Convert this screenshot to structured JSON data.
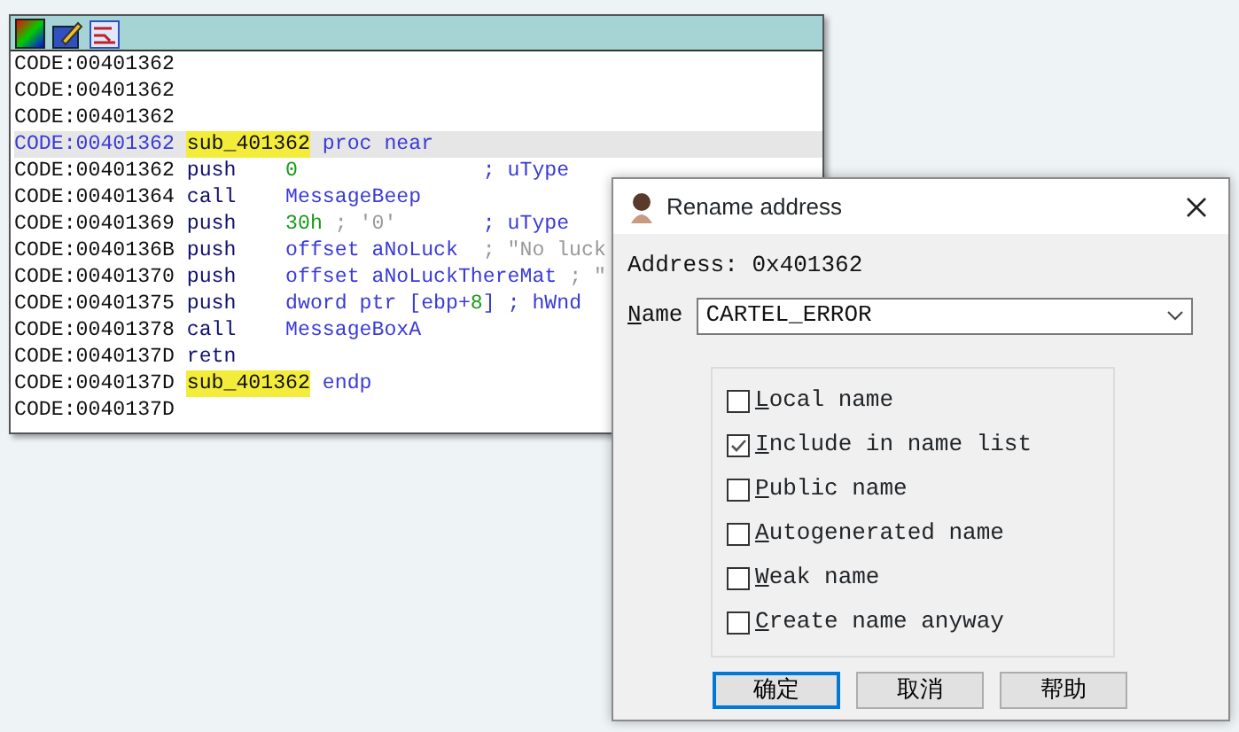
{
  "code_window": {
    "lines": [
      {
        "selected": false,
        "addr": "CODE:00401362"
      },
      {
        "selected": false,
        "addr": "CODE:00401362"
      },
      {
        "selected": false,
        "addr": "CODE:00401362"
      },
      {
        "selected": true,
        "addr": "CODE:00401362",
        "label": "sub_401362",
        "mnem": "proc near",
        "kind": "directive"
      },
      {
        "selected": false,
        "addr": "CODE:00401362",
        "mnem": "push",
        "ops": [
          {
            "kind": "num",
            "text": "0"
          }
        ],
        "cmt": [
          {
            "kind": "cmt",
            "text": "; uType"
          }
        ]
      },
      {
        "selected": false,
        "addr": "CODE:00401364",
        "mnem": "call",
        "ops": [
          {
            "kind": "name",
            "text": "MessageBeep"
          }
        ]
      },
      {
        "selected": false,
        "addr": "CODE:00401369",
        "mnem": "push",
        "ops": [
          {
            "kind": "num",
            "text": "30h"
          },
          {
            "kind": "str",
            "text": " ; '0'"
          }
        ],
        "cmt": [
          {
            "kind": "cmt",
            "text": "; uType"
          }
        ]
      },
      {
        "selected": false,
        "addr": "CODE:0040136B",
        "mnem": "push",
        "ops": [
          {
            "kind": "name",
            "text": "offset aNoLuck"
          }
        ],
        "cmt": [
          {
            "kind": "str",
            "text": "; \"No luck"
          }
        ]
      },
      {
        "selected": false,
        "addr": "CODE:00401370",
        "mnem": "push",
        "ops": [
          {
            "kind": "name",
            "text": "offset aNoLuckThereMat"
          }
        ],
        "cmt": [
          {
            "kind": "str",
            "text": "; \""
          }
        ]
      },
      {
        "selected": false,
        "addr": "CODE:00401375",
        "mnem": "push",
        "ops": [
          {
            "kind": "name",
            "text": "dword ptr [ebp+"
          },
          {
            "kind": "num",
            "text": "8"
          },
          {
            "kind": "name",
            "text": "]"
          }
        ],
        "cmt": [
          {
            "kind": "cmt",
            "text": "; hWnd"
          }
        ]
      },
      {
        "selected": false,
        "addr": "CODE:00401378",
        "mnem": "call",
        "ops": [
          {
            "kind": "name",
            "text": "MessageBoxA"
          }
        ]
      },
      {
        "selected": false,
        "addr": "CODE:0040137D",
        "mnem": "retn"
      },
      {
        "selected": false,
        "addr": "CODE:0040137D",
        "label": "sub_401362",
        "mnem": "endp",
        "kind": "directive"
      },
      {
        "selected": false,
        "addr": "CODE:0040137D"
      }
    ]
  },
  "dialog": {
    "title": "Rename address",
    "address": "Address: 0x401362",
    "name_label": "Name",
    "name_value": "CARTEL_ERROR",
    "options": [
      {
        "label": "Local name",
        "checked": false
      },
      {
        "label": "Include in name list",
        "checked": true
      },
      {
        "label": "Public name",
        "checked": false
      },
      {
        "label": "Autogenerated name",
        "checked": false
      },
      {
        "label": "Weak name",
        "checked": false
      },
      {
        "label": "Create name anyway",
        "checked": false
      }
    ],
    "buttons": [
      {
        "label": "确定",
        "default": true
      },
      {
        "label": "取消",
        "default": false
      },
      {
        "label": "帮助",
        "default": false
      }
    ]
  }
}
